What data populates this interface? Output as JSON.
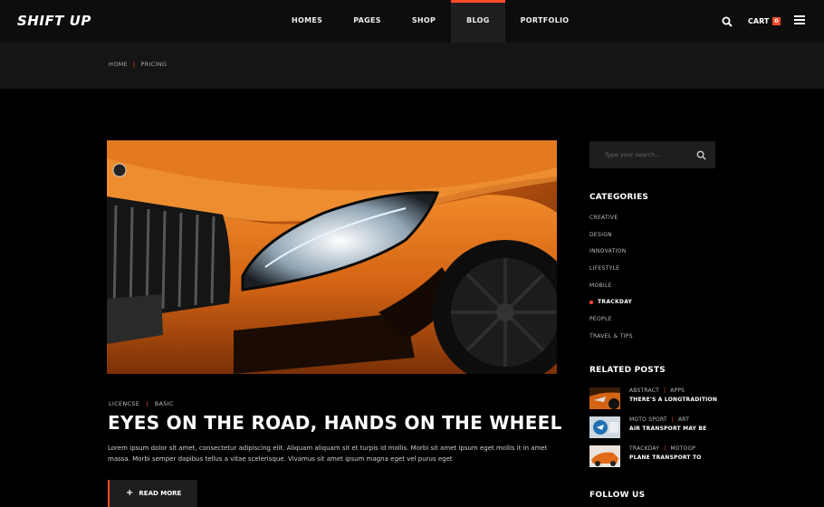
{
  "brand": {
    "logo": "SHIFT UP",
    "accent": "#ff4b2b"
  },
  "nav": {
    "items": [
      {
        "label": "HOMES"
      },
      {
        "label": "PAGES"
      },
      {
        "label": "SHOP"
      },
      {
        "label": "BLOG",
        "active": true
      },
      {
        "label": "PORTFOLIO"
      }
    ],
    "search_icon": "search-icon",
    "cart_label": "CART",
    "cart_count": "0",
    "menu_icon": "hamburger-icon"
  },
  "breadcrumb": {
    "home": "HOME",
    "separator": "|",
    "current": "PRICING"
  },
  "post": {
    "tag1": "LICENCSE",
    "tag2": "BASIC",
    "tag_sep": "|",
    "title": "EYES ON THE ROAD, HANDS ON THE WHEEL",
    "excerpt": "Lorem ipsum dolor sit amet, consectetur adipiscing elit. Aliquam aliquam sit et turpis id mollis. Morbi sit amet ipsum eget mollis it in amet massa. Morbi semper dapibus tellus a vitae scelerisque. Vivamus sit amet ipsum magna eget vel purus eget",
    "read_more": "READ MORE",
    "read_more_icon": "plus-icon"
  },
  "sidebar": {
    "search_placeholder": "Type your search...",
    "categories_title": "CATEGORIES",
    "categories": [
      {
        "label": "CREATIVE"
      },
      {
        "label": "DESIGN"
      },
      {
        "label": "INNOVATION"
      },
      {
        "label": "LIFESTYLE"
      },
      {
        "label": "MOBILE"
      },
      {
        "label": "TRACKDAY",
        "active": true
      },
      {
        "label": "PEOPLE"
      },
      {
        "label": "TRAVEL & TIPS"
      }
    ],
    "related_title": "RELATED POSTS",
    "related": [
      {
        "cat1": "ABSTRACT",
        "cat2": "APPS",
        "title": "THERE'S A LONGTRADITION"
      },
      {
        "cat1": "MOTO SPORT",
        "cat2": "ART",
        "title": "AIR TRANSPORT MAY BE"
      },
      {
        "cat1": "TRACKDAY",
        "cat2": "MOTOGP",
        "title": "PLANE TRANSPORT TO"
      }
    ],
    "follow_title": "FOLLOW US"
  }
}
